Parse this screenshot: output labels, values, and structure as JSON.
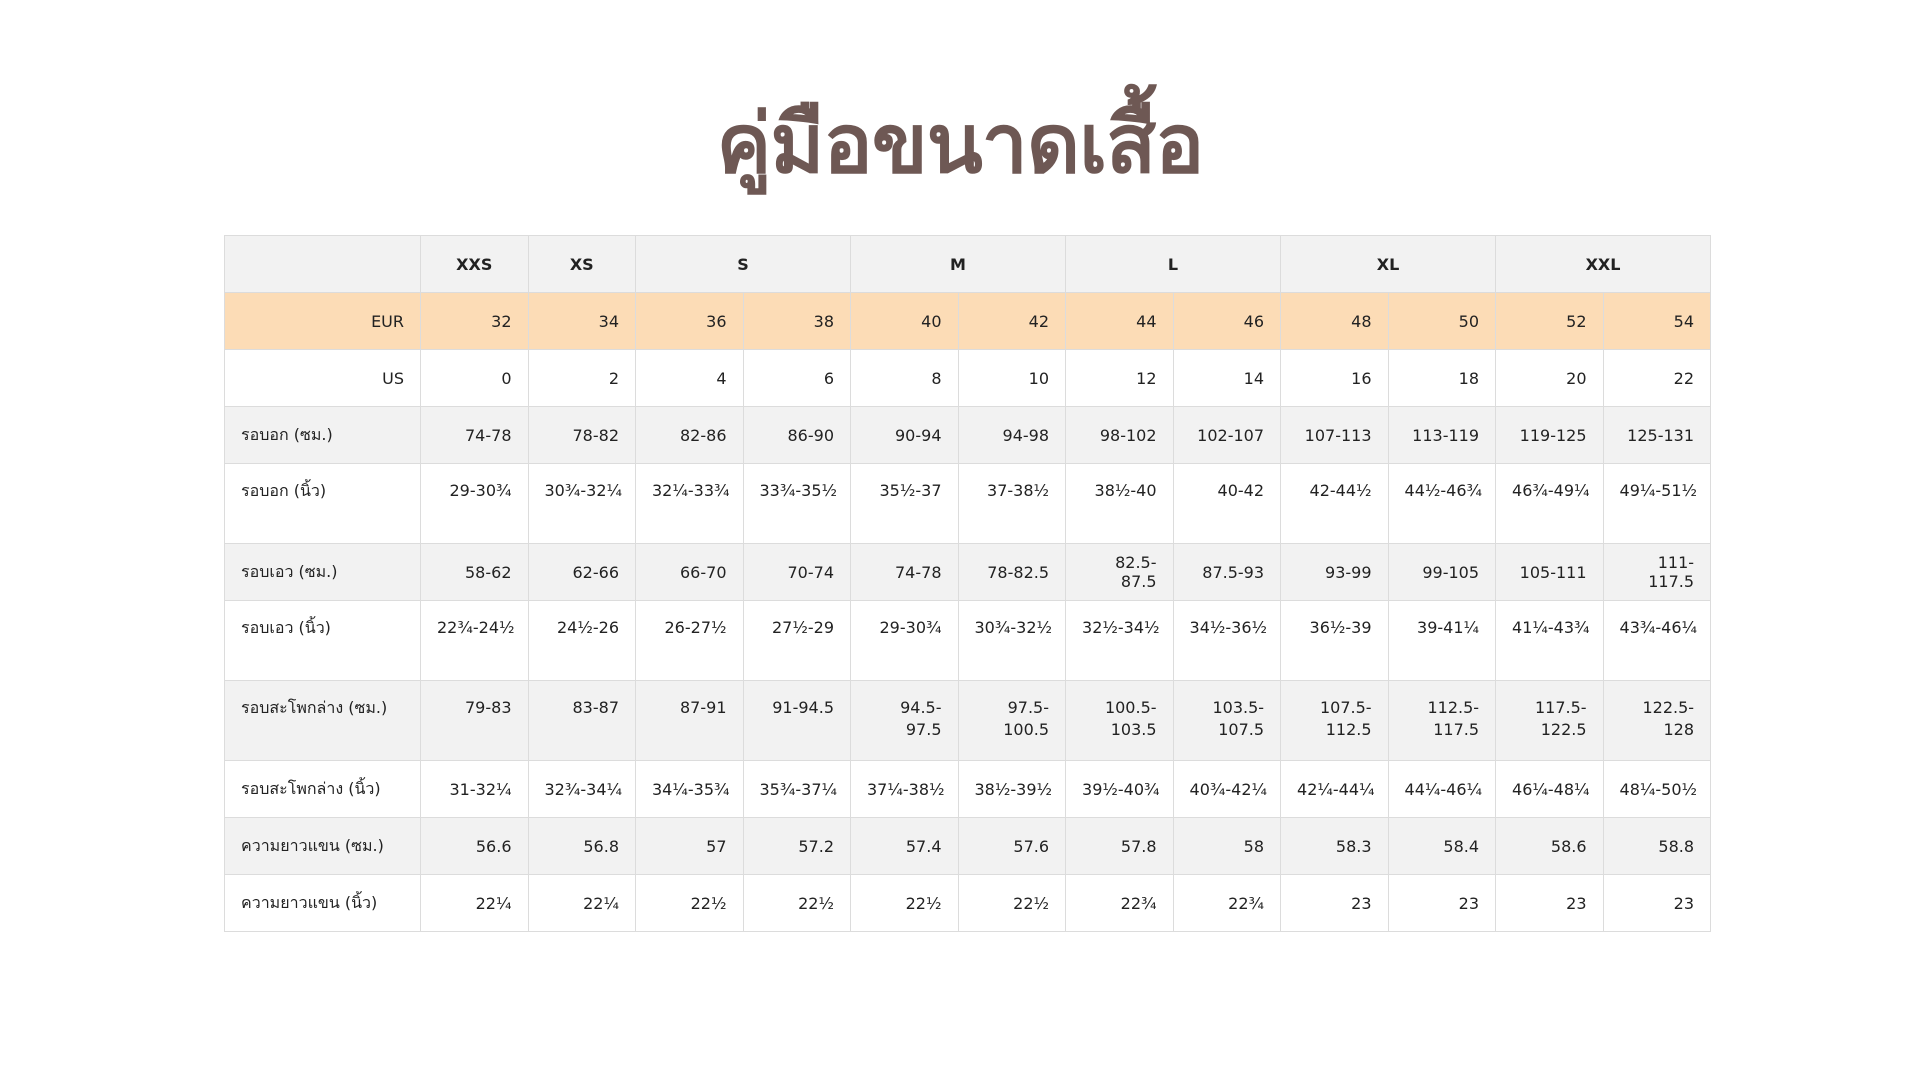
{
  "title": "คู่มือขนาดเสื้อ",
  "size_header": {
    "blank": "",
    "groups": [
      "XXS",
      "XS",
      "S",
      "M",
      "L",
      "XL",
      "XXL"
    ]
  },
  "rows": {
    "eur": {
      "label": "EUR",
      "values": [
        "32",
        "34",
        "36",
        "38",
        "40",
        "42",
        "44",
        "46",
        "48",
        "50",
        "52",
        "54"
      ]
    },
    "us": {
      "label": "US",
      "values": [
        "0",
        "2",
        "4",
        "6",
        "8",
        "10",
        "12",
        "14",
        "16",
        "18",
        "20",
        "22"
      ]
    },
    "chest_cm": {
      "label": "รอบอก (ซม.)",
      "values": [
        "74-78",
        "78-82",
        "82-86",
        "86-90",
        "90-94",
        "94-98",
        "98-102",
        "102-107",
        "107-113",
        "113-119",
        "119-125",
        "125-131"
      ]
    },
    "chest_in": {
      "label": "รอบอก (นิ้ว)",
      "values": [
        "29-30¾",
        "30¾-32¼",
        "32¼-33¾",
        "33¾-35½",
        "35½-37",
        "37-38½",
        "38½-40",
        "40-42",
        "42-44½",
        "44½-46¾",
        "46¾-49¼",
        "49¼-51½"
      ]
    },
    "waist_cm": {
      "label": "รอบเอว (ซม.)",
      "values": [
        "58-62",
        "62-66",
        "66-70",
        "70-74",
        "74-78",
        "78-82.5",
        "82.5-87.5",
        "87.5-93",
        "93-99",
        "99-105",
        "105-111",
        "111-117.5"
      ]
    },
    "waist_in": {
      "label": "รอบเอว (นิ้ว)",
      "values": [
        "22¾-24½",
        "24½-26",
        "26-27½",
        "27½-29",
        "29-30¾",
        "30¾-32½",
        "32½-34½",
        "34½-36½",
        "36½-39",
        "39-41¼",
        "41¼-43¾",
        "43¾-46¼"
      ]
    },
    "hip_cm": {
      "label": "รอบสะโพกล่าง (ซม.)",
      "values": [
        "79-83",
        "83-87",
        "87-91",
        "91-94.5",
        "94.5-97.5",
        "97.5-100.5",
        "100.5-103.5",
        "103.5-107.5",
        "107.5-112.5",
        "112.5-117.5",
        "117.5-122.5",
        "122.5-128"
      ]
    },
    "hip_in": {
      "label": "รอบสะโพกล่าง (นิ้ว)",
      "values": [
        "31-32¼",
        "32¾-34¼",
        "34¼-35¾",
        "35¾-37¼",
        "37¼-38½",
        "38½-39½",
        "39½-40¾",
        "40¾-42¼",
        "42¼-44¼",
        "44¼-46¼",
        "46¼-48¼",
        "48¼-50½"
      ]
    },
    "sleeve_cm": {
      "label": "ความยาวแขน (ซม.)",
      "values": [
        "56.6",
        "56.8",
        "57",
        "57.2",
        "57.4",
        "57.6",
        "57.8",
        "58",
        "58.3",
        "58.4",
        "58.6",
        "58.8"
      ]
    },
    "sleeve_in": {
      "label": "ความยาวแขน (นิ้ว)",
      "values": [
        "22¼",
        "22¼",
        "22½",
        "22½",
        "22½",
        "22½",
        "22¾",
        "22¾",
        "23",
        "23",
        "23",
        "23"
      ]
    }
  },
  "colors": {
    "title": "#6e5854",
    "eur_row": "#fcdcb6",
    "grey_row": "#f2f2f2",
    "border": "#dcdcdc"
  }
}
